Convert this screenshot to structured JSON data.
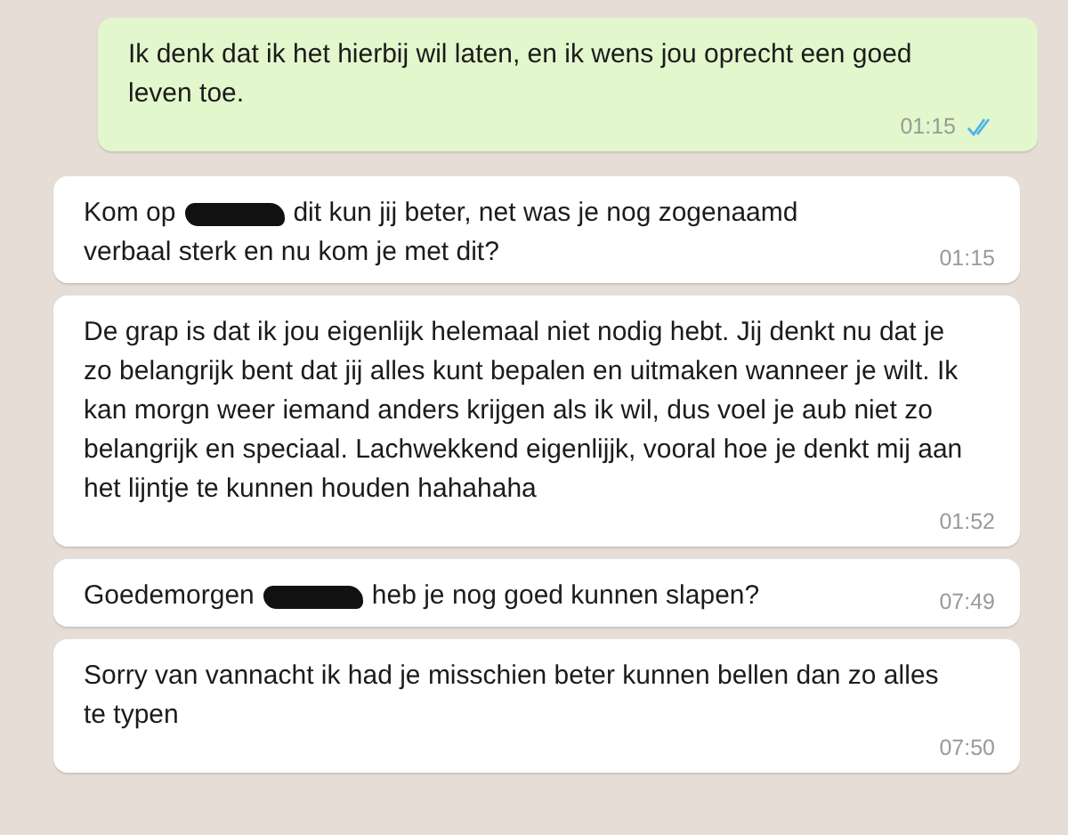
{
  "messages": [
    {
      "outgoing": true,
      "kind": "plain",
      "text": "Ik denk dat ik het hierbij wil laten, en ik wens jou oprecht een goed leven toe.",
      "time": "01:15",
      "read": true
    },
    {
      "outgoing": false,
      "kind": "redacted",
      "lines": [
        [
          {
            "kind": "text",
            "text": "Kom op"
          },
          {
            "kind": "redaction"
          },
          {
            "kind": "text",
            "text": "dit kun jij beter, net was je nog zogenaamd"
          }
        ],
        [
          {
            "kind": "text",
            "text": "verbaal sterk en nu kom je met dit?"
          }
        ]
      ],
      "time": "01:15"
    },
    {
      "outgoing": false,
      "kind": "plain",
      "text": "De grap is dat ik jou eigenlijk helemaal niet nodig hebt. Jij denkt nu dat je zo belangrijk bent dat jij alles kunt bepalen en uitmaken wanneer je wilt. Ik kan morgn weer iemand anders krijgen als ik wil, dus voel je aub niet zo belangrijk en speciaal. Lachwekkend eigenlijjk, vooral hoe je denkt mij aan het lijntje te kunnen houden hahahaha",
      "time": "01:52"
    },
    {
      "outgoing": false,
      "kind": "redacted",
      "lines": [
        [
          {
            "kind": "text",
            "text": "Goedemorgen"
          },
          {
            "kind": "redaction"
          },
          {
            "kind": "text",
            "text": "heb je nog goed kunnen slapen?"
          }
        ]
      ],
      "time": "07:49"
    },
    {
      "outgoing": false,
      "kind": "plain",
      "text": "Sorry van vannacht ik had je misschien beter kunnen bellen dan zo alles te typen",
      "time": "07:50"
    }
  ]
}
